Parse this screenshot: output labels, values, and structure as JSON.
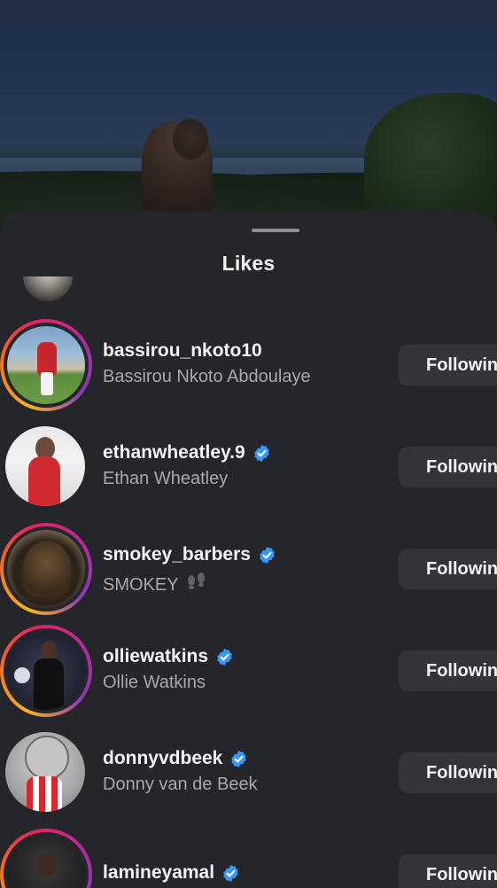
{
  "sheet": {
    "title": "Likes"
  },
  "likes": [
    {
      "username": "bassirou_nkoto10",
      "name": "Bassirou Nkoto Abdoulaye",
      "verified": false,
      "story_ring": true,
      "button": "Following"
    },
    {
      "username": "ethanwheatley.9",
      "name": "Ethan Wheatley",
      "verified": true,
      "story_ring": false,
      "button": "Following"
    },
    {
      "username": "smokey_barbers",
      "name": "SMOKEY",
      "name_suffix_icon": "footprints-emoji",
      "verified": true,
      "story_ring": true,
      "button": "Following"
    },
    {
      "username": "olliewatkins",
      "name": "Ollie Watkins",
      "verified": true,
      "story_ring": true,
      "button": "Following"
    },
    {
      "username": "donnyvdbeek",
      "name": "Donny van de Beek",
      "verified": true,
      "story_ring": false,
      "button": "Following"
    },
    {
      "username": "lamineyamal",
      "name": "",
      "verified": true,
      "story_ring": true,
      "button": "Following"
    }
  ],
  "colors": {
    "sheet_bg": "#25262b",
    "button_bg": "#34353b",
    "verified_blue": "#3897f0",
    "text_secondary": "#a8a9ae"
  },
  "icons": {
    "verified": "verified-badge-icon",
    "footprints": "footprints-icon"
  }
}
